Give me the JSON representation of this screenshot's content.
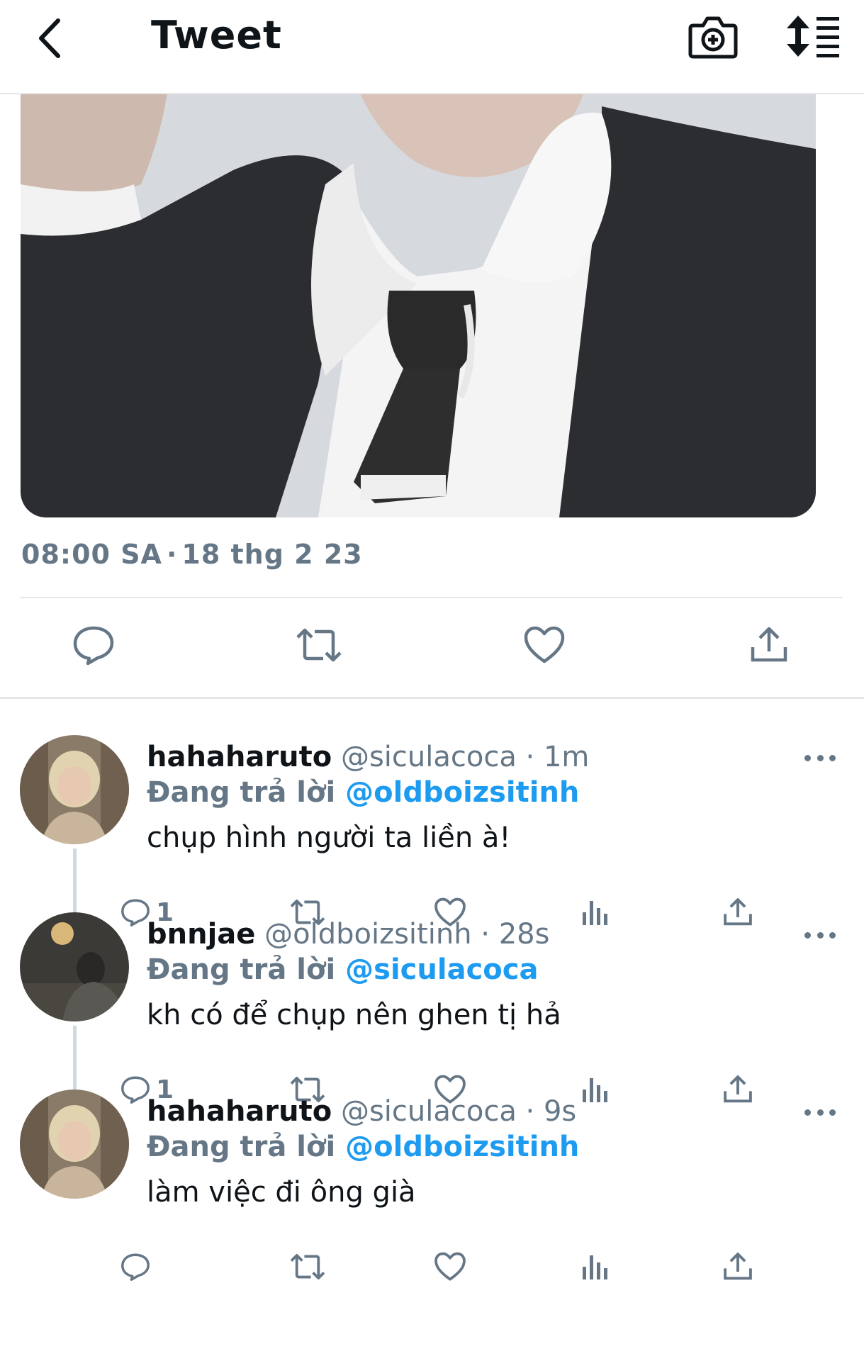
{
  "header": {
    "title": "Tweet",
    "icons": [
      "back-arrow-icon",
      "camera-plus-icon",
      "sort-list-icon"
    ]
  },
  "tweet": {
    "time": "08:00 SA",
    "date": "18 thg 2 23",
    "actions": [
      "reply-icon",
      "retweet-icon",
      "like-icon",
      "share-icon"
    ]
  },
  "replies": [
    {
      "name": "hahaharuto",
      "handle": "@siculacoca",
      "time": "1m",
      "replying_label": "Đang trả lời",
      "replying_to": "@oldboizsitinh",
      "text": "chụp hình người ta liền à!",
      "reply_count": "1",
      "avatar": "blonde"
    },
    {
      "name": "bnnjae",
      "handle": "@oldboizsitinh",
      "time": "28s",
      "replying_label": "Đang trả lời",
      "replying_to": "@siculacoca",
      "text": "kh có để chụp nên ghen tị hả",
      "reply_count": "1",
      "avatar": "dark"
    },
    {
      "name": "hahaharuto",
      "handle": "@siculacoca",
      "time": "9s",
      "replying_label": "Đang trả lời",
      "replying_to": "@oldboizsitinh",
      "text": "làm việc đi ông già",
      "reply_count": "",
      "avatar": "blonde"
    }
  ],
  "colors": {
    "text": "#0f1419",
    "muted": "#657786",
    "link": "#1d9bf0",
    "divider": "#e6e6e6"
  }
}
